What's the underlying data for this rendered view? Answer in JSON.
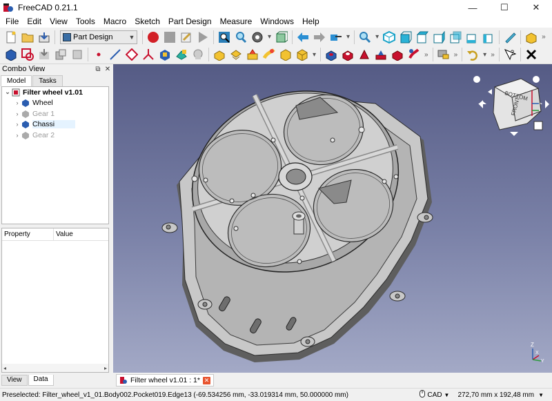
{
  "window": {
    "title": "FreeCAD 0.21.1",
    "minimize": "—",
    "maximize": "☐",
    "close": "✕"
  },
  "menu": [
    "File",
    "Edit",
    "View",
    "Tools",
    "Macro",
    "Sketch",
    "Part Design",
    "Measure",
    "Windows",
    "Help"
  ],
  "toolbar": {
    "workbench": "Part Design",
    "more": "»"
  },
  "combo_view": {
    "title": "Combo View",
    "tabs": [
      "Model",
      "Tasks"
    ],
    "tree": [
      {
        "label": "Filter wheel v1.01",
        "type": "root"
      },
      {
        "label": "Wheel",
        "visible": true
      },
      {
        "label": "Gear 1",
        "visible": false
      },
      {
        "label": "Chassi",
        "visible": true,
        "selected": true
      },
      {
        "label": "Gear 2",
        "visible": false
      }
    ],
    "property_header": [
      "Property",
      "Value"
    ],
    "bottom_tabs": [
      "View",
      "Data"
    ]
  },
  "navcube": {
    "faces": [
      "BOTTOM",
      "FRONT"
    ]
  },
  "axes": {
    "x": "X",
    "y": "Y",
    "z": "Z"
  },
  "document_tab": {
    "label": "Filter wheel v1.01 : 1*"
  },
  "status": {
    "message": "Preselected: Filter_wheel_v1_01.Body002.Pocket019.Edge13 (-69.534256 mm, -33.019314 mm, 50.000000 mm)",
    "navigation": "CAD",
    "dimensions": "272,70 mm x 192,48 mm"
  }
}
